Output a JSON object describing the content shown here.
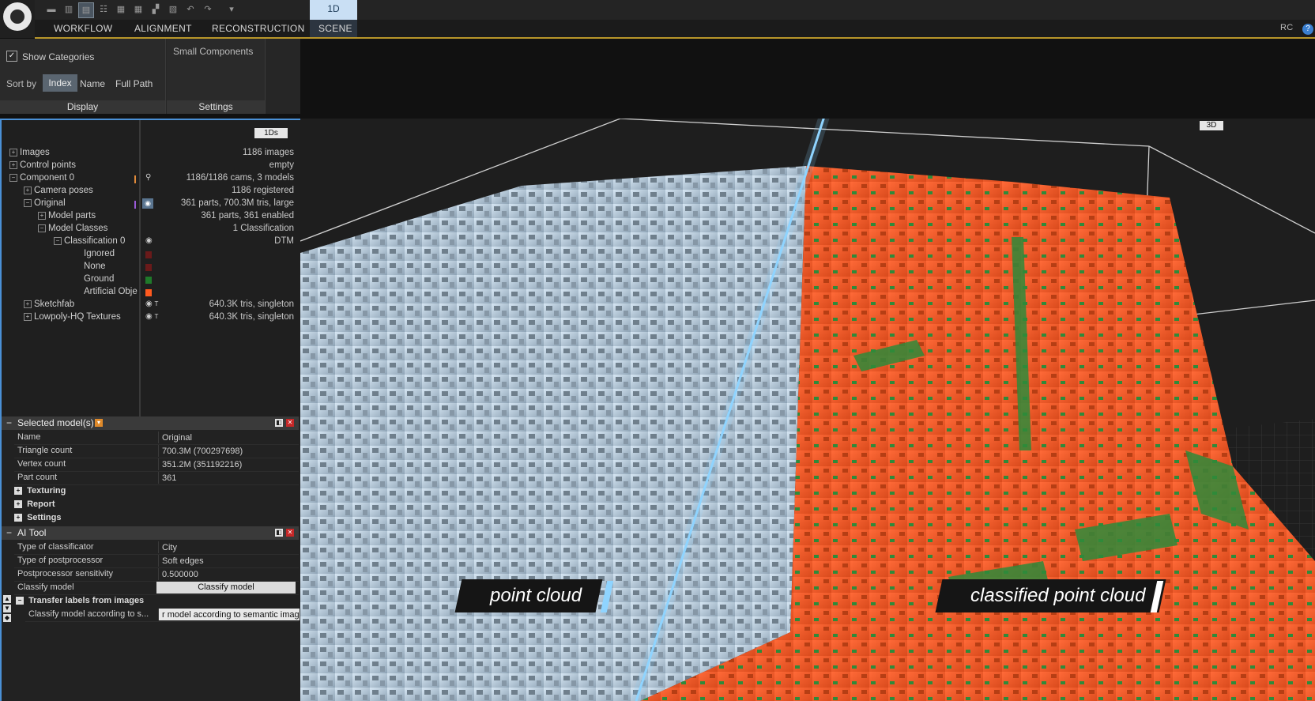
{
  "app": {
    "short_name": "RC",
    "help_icon": "help-icon"
  },
  "topbar": {
    "tab_active_label": "1D",
    "toolbar_icons": [
      "layout-1-icon",
      "layout-2-icon",
      "layout-3-icon",
      "layout-4-icon",
      "layout-5-icon",
      "layout-6-icon",
      "layout-7-icon",
      "layout-8-icon",
      "undo-icon",
      "redo-icon",
      "quick-access-icon"
    ]
  },
  "menu": {
    "items": [
      "WORKFLOW",
      "ALIGNMENT",
      "RECONSTRUCTION",
      "SCENE"
    ],
    "active": "SCENE"
  },
  "ribbon": {
    "display": {
      "show_categories_label": "Show Categories",
      "show_categories_checked": true,
      "sort_by_label": "Sort by",
      "sort_options": [
        "Index",
        "Name",
        "Full Path"
      ],
      "sort_selected": "Index",
      "group_label": "Display"
    },
    "settings": {
      "small_components_label": "Small Components",
      "group_label": "Settings"
    }
  },
  "tree": {
    "view_badge": "1Ds",
    "rows": [
      {
        "label": "Images",
        "value": "1186 images"
      },
      {
        "label": "Control points",
        "value": "empty"
      },
      {
        "label": "Component 0",
        "value": "1186/1186 cams, 3 models"
      },
      {
        "label": "Camera poses",
        "value": "1186 registered"
      },
      {
        "label": "Original",
        "value": "361 parts, 700.3M tris, large"
      },
      {
        "label": "Model parts",
        "value": "361 parts, 361 enabled"
      },
      {
        "label": "Model Classes",
        "value": "1 Classification"
      },
      {
        "label": "Classification 0",
        "value": "DTM"
      },
      {
        "label": "Ignored",
        "value": ""
      },
      {
        "label": "None",
        "value": ""
      },
      {
        "label": "Ground",
        "value": ""
      },
      {
        "label": "Artificial Obje",
        "value": ""
      },
      {
        "label": "Sketchfab",
        "value": "640.3K tris, singleton"
      },
      {
        "label": "Lowpoly-HQ Textures",
        "value": "640.3K tris, singleton"
      }
    ],
    "class_colors": {
      "ignored": "#6a1a1a",
      "none": "#6a1a1a",
      "ground": "#1f7a2a",
      "artificial": "#ff5a1f"
    }
  },
  "selected_models": {
    "title": "Selected model(s)",
    "rows": [
      {
        "key": "Name",
        "value": "Original"
      },
      {
        "key": "Triangle count",
        "value": "700.3M (700297698)"
      },
      {
        "key": "Vertex count",
        "value": "351.2M (351192216)"
      },
      {
        "key": "Part count",
        "value": "361"
      }
    ],
    "sections": [
      "Texturing",
      "Report",
      "Settings"
    ]
  },
  "ai_tool": {
    "title": "AI Tool",
    "rows": [
      {
        "key": "Type of classificator",
        "value": "City"
      },
      {
        "key": "Type of postprocessor",
        "value": "Soft edges"
      },
      {
        "key": "Postprocessor sensitivity",
        "value": "0.500000"
      }
    ],
    "classify_key": "Classify model",
    "classify_button": "Classify model",
    "transfer_section": "Transfer labels from images",
    "transfer_key": "Classify model according to s...",
    "transfer_value": "r model according to semantic image"
  },
  "viewport": {
    "badge": "3D",
    "label_left": "point cloud",
    "label_right": "classified point cloud",
    "colors": {
      "artificial": "#ff5a2a",
      "ground": "#2f8a3a",
      "point_cloud": "#c9dceb",
      "divider": "#8fd4ff"
    }
  }
}
